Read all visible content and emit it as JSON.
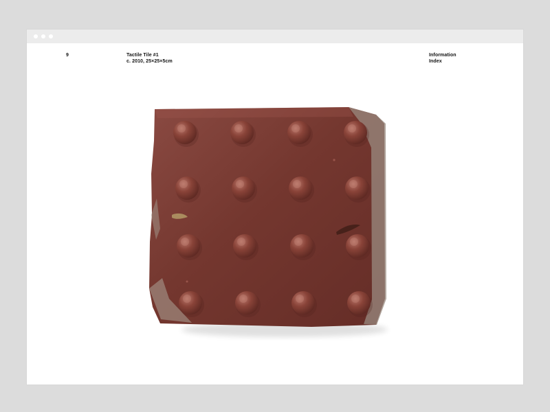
{
  "window": {
    "controls": [
      "window-dot",
      "window-dot",
      "window-dot"
    ]
  },
  "page": {
    "number": "9",
    "title": "Tactile Tile #1",
    "details": "c. 2010, 25×25×5cm"
  },
  "nav": {
    "information": "Information",
    "index": "Index"
  },
  "colors": {
    "background": "#dcdcdc",
    "window": "#ffffff",
    "titlebar": "#ececec",
    "tile": "#7a3d35"
  },
  "image": {
    "subject": "tactile-paving-tile"
  }
}
